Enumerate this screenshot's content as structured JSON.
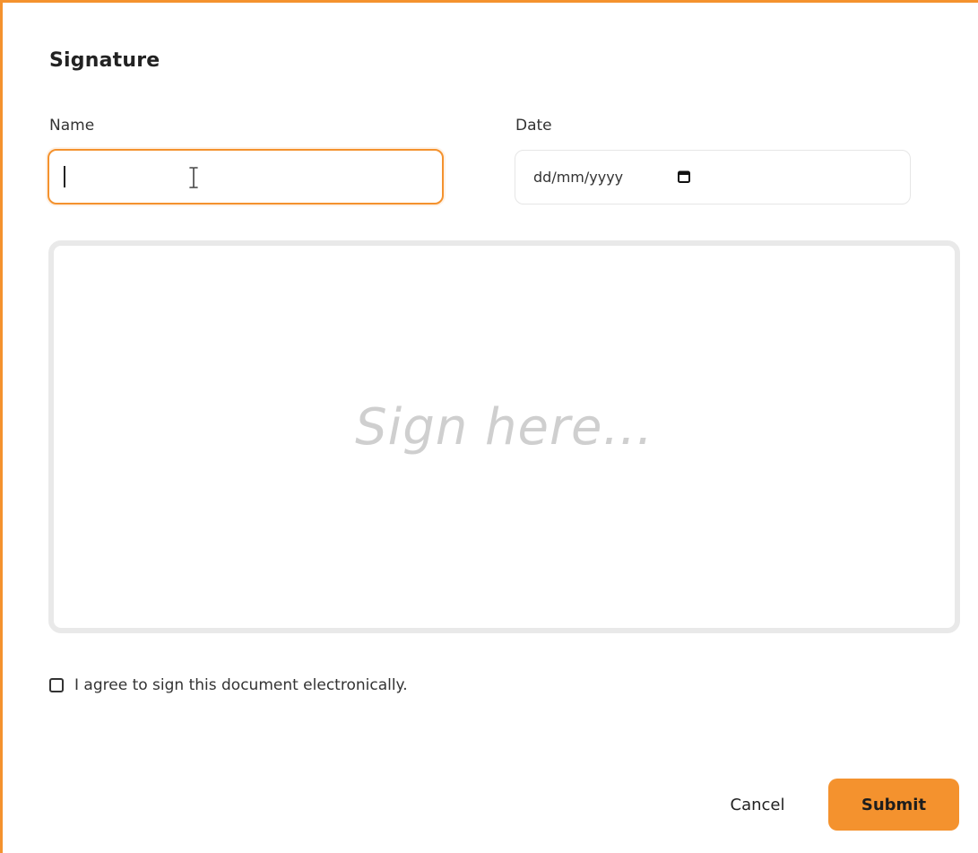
{
  "dialog": {
    "title": "Signature"
  },
  "form": {
    "name_label": "Name",
    "name_value": "",
    "date_label": "Date",
    "date_placeholder": "dd/mm/yyyy",
    "signature_placeholder": "Sign here...",
    "agree_label": "I agree to sign this document electronically.",
    "agree_checked": false
  },
  "actions": {
    "cancel_label": "Cancel",
    "submit_label": "Submit"
  },
  "icons": {
    "calendar": "calendar-icon",
    "text_cursor": "text-cursor-icon"
  },
  "colors": {
    "accent": "#f4922e",
    "placeholder": "#cfcfcf",
    "border": "#e6e6e6"
  }
}
